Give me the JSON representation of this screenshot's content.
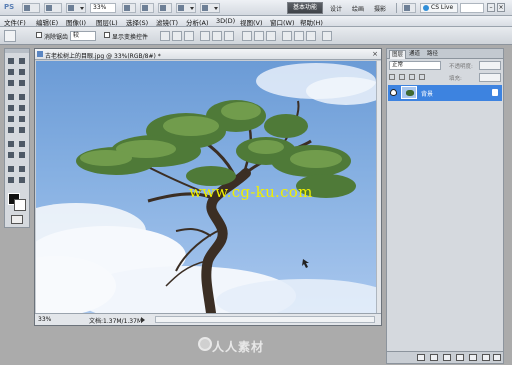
{
  "app": {
    "logo": "PS",
    "zoom": "33%",
    "workspace_button": "基本功能",
    "workspace_links": [
      "设计",
      "绘画",
      "摄影"
    ],
    "cs_live": "CS Live"
  },
  "menu": [
    "文件(F)",
    "编辑(E)",
    "图像(I)",
    "图层(L)",
    "选择(S)",
    "滤镜(T)",
    "分析(A)",
    "3D(D)",
    "视图(V)",
    "窗口(W)",
    "帮助(H)"
  ],
  "options": {
    "feather_label": "消除锯齿",
    "style_select": "较",
    "refine_label": "显示变换控件"
  },
  "document": {
    "title": "古老松树上的目眼.jpg @ 33%(RGB/8#) *",
    "zoom_pct": "33%",
    "doc_info": "文档:1.37M/1.37M",
    "watermark_url": "www.cg-ku.com"
  },
  "layers_panel": {
    "tabs": [
      "图层",
      "通道",
      "路径"
    ],
    "blend_mode": "正常",
    "opacity_label": "不透明度:",
    "fill_label": "填充:",
    "layer_name": "背景"
  },
  "brand_watermark": "人人素材",
  "colors": {
    "sky_top": "#6b9bd6",
    "layer_selected": "#3d83e0",
    "watermark": "#f0f000"
  }
}
